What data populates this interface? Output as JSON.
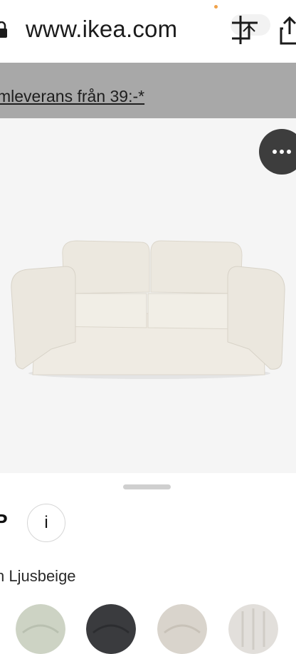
{
  "browser": {
    "url": "www.ikea.com",
    "icons": [
      "lock-icon",
      "crop-icon",
      "share-icon"
    ]
  },
  "promo": {
    "text": "mleverans från 39:-*"
  },
  "product": {
    "more_icon": "ellipsis-icon"
  },
  "sheet": {
    "name_fragment": "P",
    "info_label": "i",
    "color_label": "n Ljusbeige",
    "swatches": [
      {
        "color": "#cdd3c4"
      },
      {
        "color": "#3a3b3e"
      },
      {
        "color": "#d9d4cc"
      },
      {
        "color": "#e2dfdb"
      }
    ]
  }
}
